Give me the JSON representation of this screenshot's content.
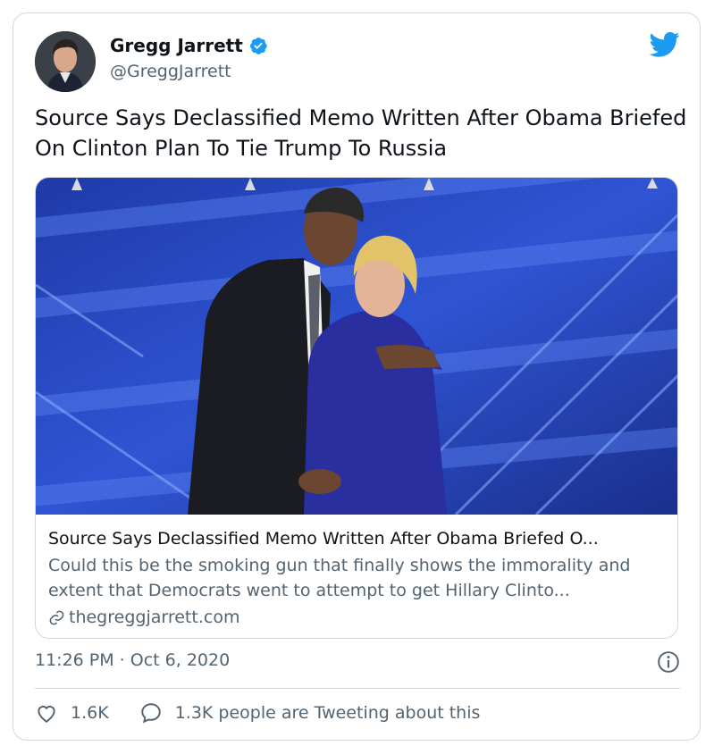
{
  "author": {
    "name": "Gregg Jarrett",
    "handle": "@GreggJarrett"
  },
  "tweet": {
    "text": "Source Says Declassified Memo Written After Obama Briefed On Clinton Plan To Tie Trump To Russia",
    "timestamp": "11:26 PM · Oct 6, 2020"
  },
  "link_card": {
    "title": "Source Says Declassified Memo Written After Obama Briefed O...",
    "description": "Could this be the smoking gun that finally shows the immorality and extent that Democrats went to attempt to get Hillary Clinto...",
    "domain": "thegreggjarrett.com"
  },
  "actions": {
    "likes": "1.6K",
    "replies_label": "1.3K people are Tweeting about this"
  },
  "icons": {
    "verified": "verified-badge-icon",
    "brand": "twitter-bird-icon",
    "info": "info-icon",
    "like": "heart-icon",
    "reply": "speech-bubble-icon",
    "link": "link-icon"
  },
  "colors": {
    "brand_blue": "#1d9bf0",
    "text_primary": "#0f1419",
    "text_secondary": "#536471",
    "border": "#cfd9de"
  }
}
